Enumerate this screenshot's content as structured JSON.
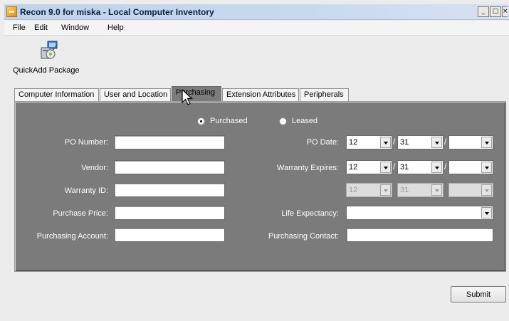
{
  "window": {
    "title": "Recon 9.0 for miska - Local Computer Inventory",
    "controls": {
      "minimize": "_",
      "maximize": "□",
      "close": "×"
    }
  },
  "menu": [
    "File",
    "Edit",
    "Window",
    "Help"
  ],
  "toolbar": {
    "quickadd_label": "QuickAdd Package",
    "quickadd_icon": "package-install-icon"
  },
  "tabs": [
    {
      "label": "Computer Information",
      "active": false
    },
    {
      "label": "User and Location",
      "active": false
    },
    {
      "label": "Purchasing",
      "active": true
    },
    {
      "label": "Extension Attributes",
      "active": false
    },
    {
      "label": "Peripherals",
      "active": false
    }
  ],
  "purchase_type": {
    "options": [
      {
        "label": "Purchased",
        "checked": true
      },
      {
        "label": "Leased",
        "checked": false
      }
    ]
  },
  "fields_left": {
    "po_number": {
      "label": "PO Number:",
      "value": ""
    },
    "vendor": {
      "label": "Vendor:",
      "value": ""
    },
    "warranty_id": {
      "label": "Warranty ID:",
      "value": ""
    },
    "purchase_price": {
      "label": "Purchase Price:",
      "value": ""
    },
    "purchasing_account": {
      "label": "Purchasing Account:",
      "value": ""
    }
  },
  "fields_right": {
    "po_date": {
      "label": "PO Date:",
      "month": "12",
      "day": "31",
      "year": ""
    },
    "warranty_expires": {
      "label": "Warranty Expires:",
      "month": "12",
      "day": "31",
      "year": ""
    },
    "lease_expires": {
      "month": "12",
      "day": "31",
      "year": ""
    },
    "life_expectancy": {
      "label": "Life Expectancy:",
      "value": ""
    },
    "purchasing_contact": {
      "label": "Purchasing Contact:",
      "value": ""
    }
  },
  "date_separator": "/",
  "buttons": {
    "submit": "Submit"
  },
  "colors": {
    "panel_bg": "#7b7b7b",
    "title_text": "#0b1f44",
    "field_label": "#ffffff"
  }
}
